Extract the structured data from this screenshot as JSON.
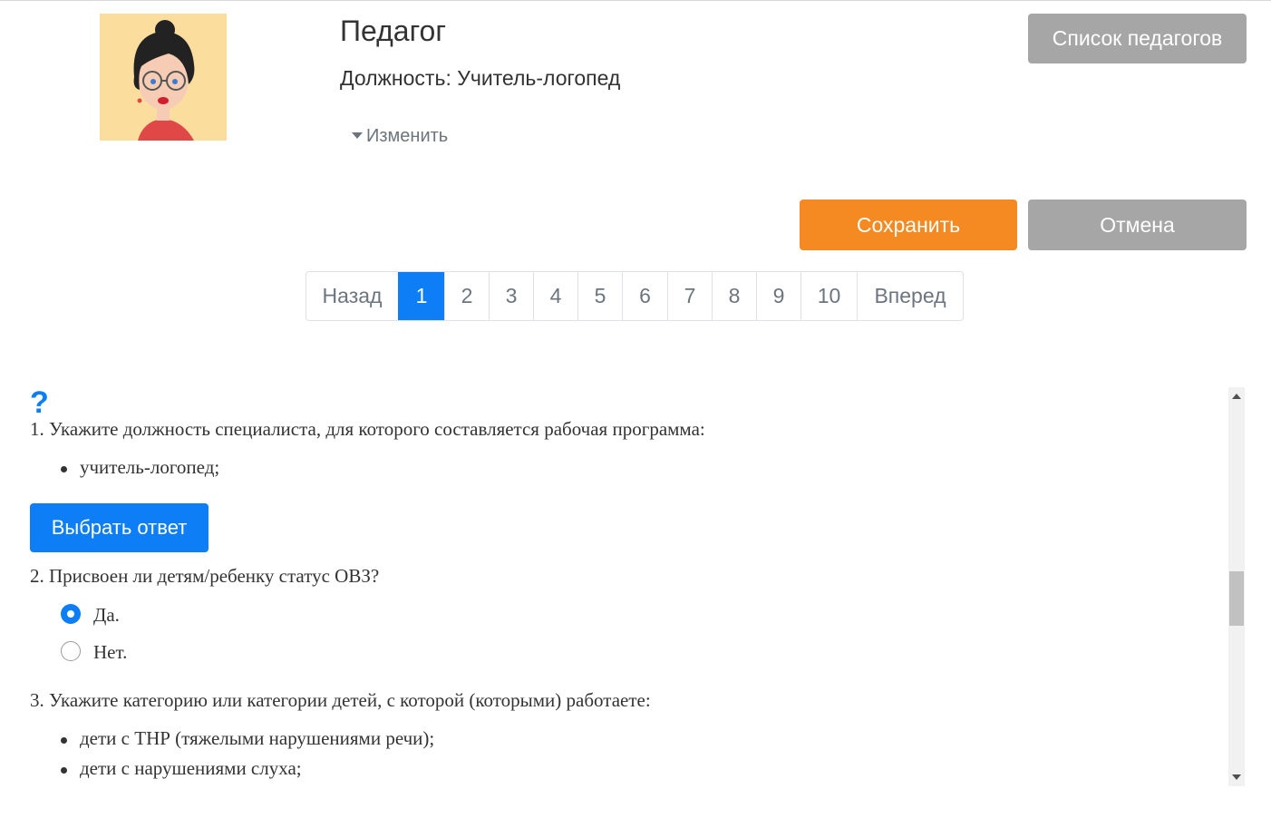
{
  "header": {
    "title": "Педагог",
    "position_label": "Должность:",
    "position_value": "Учитель-логопед",
    "change_label": "Изменить",
    "list_button": "Список педагогов"
  },
  "actions": {
    "save": "Сохранить",
    "cancel": "Отмена"
  },
  "pagination": {
    "prev": "Назад",
    "next": "Вперед",
    "pages": [
      "1",
      "2",
      "3",
      "4",
      "5",
      "6",
      "7",
      "8",
      "9",
      "10"
    ],
    "current": "1"
  },
  "questions": {
    "help_icon": "?",
    "q1": {
      "text": "1. Укажите должность специалиста, для которого составляется рабочая программа:",
      "answers": [
        "учитель-логопед;"
      ],
      "choose_button": "Выбрать ответ"
    },
    "q2": {
      "text": "2. Присвоен ли детям/ребенку статус ОВЗ?",
      "options": [
        "Да.",
        "Нет."
      ],
      "selected": "Да."
    },
    "q3": {
      "text": "3. Укажите категорию или категории детей, с которой (которыми) работаете:",
      "answers": [
        "дети с ТНР (тяжелыми нарушениями речи);",
        "дети с нарушениями слуха;"
      ]
    }
  },
  "colors": {
    "primary": "#0d7ef5",
    "save": "#f58a22",
    "gray_button": "#a6a6a6",
    "avatar_bg": "#fbdd9e"
  }
}
